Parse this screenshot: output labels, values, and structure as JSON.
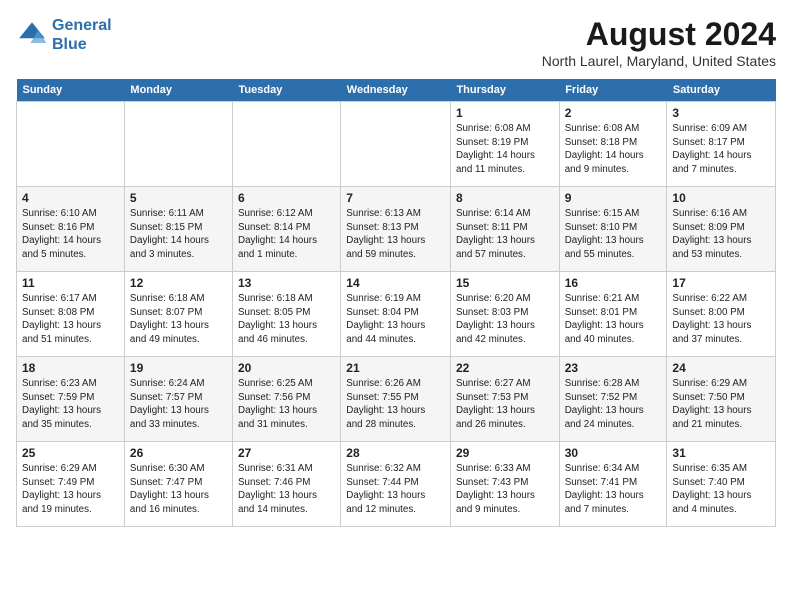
{
  "logo": {
    "line1": "General",
    "line2": "Blue"
  },
  "title": "August 2024",
  "subtitle": "North Laurel, Maryland, United States",
  "headers": [
    "Sunday",
    "Monday",
    "Tuesday",
    "Wednesday",
    "Thursday",
    "Friday",
    "Saturday"
  ],
  "weeks": [
    [
      {
        "day": "",
        "info": ""
      },
      {
        "day": "",
        "info": ""
      },
      {
        "day": "",
        "info": ""
      },
      {
        "day": "",
        "info": ""
      },
      {
        "day": "1",
        "info": "Sunrise: 6:08 AM\nSunset: 8:19 PM\nDaylight: 14 hours\nand 11 minutes."
      },
      {
        "day": "2",
        "info": "Sunrise: 6:08 AM\nSunset: 8:18 PM\nDaylight: 14 hours\nand 9 minutes."
      },
      {
        "day": "3",
        "info": "Sunrise: 6:09 AM\nSunset: 8:17 PM\nDaylight: 14 hours\nand 7 minutes."
      }
    ],
    [
      {
        "day": "4",
        "info": "Sunrise: 6:10 AM\nSunset: 8:16 PM\nDaylight: 14 hours\nand 5 minutes."
      },
      {
        "day": "5",
        "info": "Sunrise: 6:11 AM\nSunset: 8:15 PM\nDaylight: 14 hours\nand 3 minutes."
      },
      {
        "day": "6",
        "info": "Sunrise: 6:12 AM\nSunset: 8:14 PM\nDaylight: 14 hours\nand 1 minute."
      },
      {
        "day": "7",
        "info": "Sunrise: 6:13 AM\nSunset: 8:13 PM\nDaylight: 13 hours\nand 59 minutes."
      },
      {
        "day": "8",
        "info": "Sunrise: 6:14 AM\nSunset: 8:11 PM\nDaylight: 13 hours\nand 57 minutes."
      },
      {
        "day": "9",
        "info": "Sunrise: 6:15 AM\nSunset: 8:10 PM\nDaylight: 13 hours\nand 55 minutes."
      },
      {
        "day": "10",
        "info": "Sunrise: 6:16 AM\nSunset: 8:09 PM\nDaylight: 13 hours\nand 53 minutes."
      }
    ],
    [
      {
        "day": "11",
        "info": "Sunrise: 6:17 AM\nSunset: 8:08 PM\nDaylight: 13 hours\nand 51 minutes."
      },
      {
        "day": "12",
        "info": "Sunrise: 6:18 AM\nSunset: 8:07 PM\nDaylight: 13 hours\nand 49 minutes."
      },
      {
        "day": "13",
        "info": "Sunrise: 6:18 AM\nSunset: 8:05 PM\nDaylight: 13 hours\nand 46 minutes."
      },
      {
        "day": "14",
        "info": "Sunrise: 6:19 AM\nSunset: 8:04 PM\nDaylight: 13 hours\nand 44 minutes."
      },
      {
        "day": "15",
        "info": "Sunrise: 6:20 AM\nSunset: 8:03 PM\nDaylight: 13 hours\nand 42 minutes."
      },
      {
        "day": "16",
        "info": "Sunrise: 6:21 AM\nSunset: 8:01 PM\nDaylight: 13 hours\nand 40 minutes."
      },
      {
        "day": "17",
        "info": "Sunrise: 6:22 AM\nSunset: 8:00 PM\nDaylight: 13 hours\nand 37 minutes."
      }
    ],
    [
      {
        "day": "18",
        "info": "Sunrise: 6:23 AM\nSunset: 7:59 PM\nDaylight: 13 hours\nand 35 minutes."
      },
      {
        "day": "19",
        "info": "Sunrise: 6:24 AM\nSunset: 7:57 PM\nDaylight: 13 hours\nand 33 minutes."
      },
      {
        "day": "20",
        "info": "Sunrise: 6:25 AM\nSunset: 7:56 PM\nDaylight: 13 hours\nand 31 minutes."
      },
      {
        "day": "21",
        "info": "Sunrise: 6:26 AM\nSunset: 7:55 PM\nDaylight: 13 hours\nand 28 minutes."
      },
      {
        "day": "22",
        "info": "Sunrise: 6:27 AM\nSunset: 7:53 PM\nDaylight: 13 hours\nand 26 minutes."
      },
      {
        "day": "23",
        "info": "Sunrise: 6:28 AM\nSunset: 7:52 PM\nDaylight: 13 hours\nand 24 minutes."
      },
      {
        "day": "24",
        "info": "Sunrise: 6:29 AM\nSunset: 7:50 PM\nDaylight: 13 hours\nand 21 minutes."
      }
    ],
    [
      {
        "day": "25",
        "info": "Sunrise: 6:29 AM\nSunset: 7:49 PM\nDaylight: 13 hours\nand 19 minutes."
      },
      {
        "day": "26",
        "info": "Sunrise: 6:30 AM\nSunset: 7:47 PM\nDaylight: 13 hours\nand 16 minutes."
      },
      {
        "day": "27",
        "info": "Sunrise: 6:31 AM\nSunset: 7:46 PM\nDaylight: 13 hours\nand 14 minutes."
      },
      {
        "day": "28",
        "info": "Sunrise: 6:32 AM\nSunset: 7:44 PM\nDaylight: 13 hours\nand 12 minutes."
      },
      {
        "day": "29",
        "info": "Sunrise: 6:33 AM\nSunset: 7:43 PM\nDaylight: 13 hours\nand 9 minutes."
      },
      {
        "day": "30",
        "info": "Sunrise: 6:34 AM\nSunset: 7:41 PM\nDaylight: 13 hours\nand 7 minutes."
      },
      {
        "day": "31",
        "info": "Sunrise: 6:35 AM\nSunset: 7:40 PM\nDaylight: 13 hours\nand 4 minutes."
      }
    ]
  ]
}
